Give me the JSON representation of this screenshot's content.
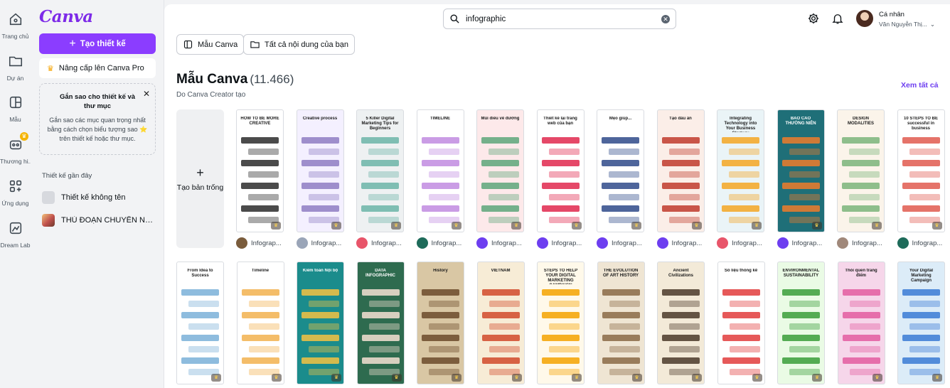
{
  "rail": [
    {
      "label": "Trang chủ",
      "icon": "home-icon"
    },
    {
      "label": "Dự án",
      "icon": "folder-icon"
    },
    {
      "label": "Mẫu",
      "icon": "template-icon"
    },
    {
      "label": "Thương hi...",
      "icon": "brand-icon",
      "badge": "♛"
    },
    {
      "label": "Ứng dụng",
      "icon": "apps-icon"
    },
    {
      "label": "Dream Lab",
      "icon": "dream-lab-icon"
    }
  ],
  "panel": {
    "logo": "Canva",
    "create_label": "Tạo thiết kế",
    "upgrade_label": "Nâng cấp lên Canva Pro",
    "tip_title": "Gắn sao cho thiết kế và thư mục",
    "tip_body": "Gắn sao các mục quan trọng nhất bằng cách chọn biểu tượng sao ⭐ trên thiết kế hoặc thư mục.",
    "close_glyph": "✕",
    "recent_title": "Thiết kế gần đây",
    "recent": [
      {
        "label": "Thiết kế không tên"
      },
      {
        "label": "THỦ ĐOẠN CHUYỂN NH..."
      }
    ]
  },
  "header": {
    "search_value": "infographic",
    "clear_glyph": "✕",
    "account_name": "Cá nhân",
    "account_user": "Văn Nguyễn Thị...",
    "account_caret": "⌄"
  },
  "filters": [
    {
      "label": "Mẫu Canva"
    },
    {
      "label": "Tất cả nội dung của bạn"
    }
  ],
  "section": {
    "title": "Mẫu Canva",
    "count": "(11.466)",
    "subtitle": "Do Canva Creator tạo",
    "see_all": "Xem tất cả",
    "blank_label": "Tạo bản trống",
    "blank_plus": "+"
  },
  "row1": [
    {
      "title": "HOW TO BE MORE CREATIVE",
      "bg": "#ffffff",
      "accent": "#2b2b2b",
      "avatar": "#7a5c3c",
      "author": "Infograp..."
    },
    {
      "title": "Creative process",
      "bg": "#f4f0ff",
      "accent": "#8e7cc3",
      "avatar": "#9aa5b8",
      "author": "Infograp..."
    },
    {
      "title": "5 Killer Digital Marketing Tips for Beginners",
      "bg": "#eef1f2",
      "accent": "#6bb5a8",
      "avatar": "#e8556a",
      "author": "Infograp..."
    },
    {
      "title": "TIMELINE",
      "bg": "#ffffff",
      "accent": "#c18be0",
      "avatar": "#1e6b5a",
      "author": "Infograp..."
    },
    {
      "title": "Mùi điều về đường",
      "bg": "#fde9ea",
      "accent": "#5da67a",
      "avatar": "#6d3ef0",
      "author": "Infograp..."
    },
    {
      "title": "Thiết kế lại trang web của bạn",
      "bg": "#ffffff",
      "accent": "#e0284e",
      "avatar": "#6d3ef0",
      "author": "Infograp..."
    },
    {
      "title": "Mẹo giúp...",
      "bg": "#ffffff",
      "accent": "#2f4a8a",
      "avatar": "#6d3ef0",
      "author": "Infograp..."
    },
    {
      "title": "Tạo dấu ấn",
      "bg": "#fbeee8",
      "accent": "#c0392b",
      "avatar": "#6d3ef0",
      "author": "Infograp..."
    },
    {
      "title": "Integrating Technology into Your Business Strategy",
      "bg": "#eaf4f7",
      "accent": "#f5a623",
      "avatar": "#e8556a",
      "author": "Infograp..."
    },
    {
      "title": "BÁO CÁO THƯỜNG NIÊN",
      "bg": "#1f6f78",
      "accent": "#ef7d2a",
      "avatar": "#6d3ef0",
      "author": "Infograp..."
    },
    {
      "title": "DESIGN MODALITIES",
      "bg": "#fbf4ea",
      "accent": "#7ab47a",
      "avatar": "#a0887a",
      "author": "Infograp..."
    },
    {
      "title": "10 STEPS TO BE successful in business",
      "bg": "#ffffff",
      "accent": "#e05a4f",
      "avatar": "#1e6b5a",
      "author": "Infograp..."
    }
  ],
  "row2": [
    {
      "title": "From Idea to Success",
      "bg": "#ffffff",
      "accent": "#7ab0d8",
      "author": ""
    },
    {
      "title": "Timeline",
      "bg": "#ffffff",
      "accent": "#f2b24f",
      "author": ""
    },
    {
      "title": "Kiểm toán Nội bộ",
      "bg": "#1b8c8c",
      "accent": "#f5c242",
      "author": ""
    },
    {
      "title": "DATA INFOGRAPHIC",
      "bg": "#2e6b4f",
      "accent": "#f4e1d2",
      "author": ""
    },
    {
      "title": "History",
      "bg": "#d9c7a4",
      "accent": "#6b4a2b",
      "author": ""
    },
    {
      "title": "VIETNAM",
      "bg": "#f7ecd6",
      "accent": "#d14a2a",
      "author": ""
    },
    {
      "title": "STEPS TO HELP YOUR DIGITAL MARKETING CAMPAIGN SUCCESS",
      "bg": "#fff9ea",
      "accent": "#f5a300",
      "author": ""
    },
    {
      "title": "THE EVOLUTION OF ART HISTORY",
      "bg": "#efe5d3",
      "accent": "#8a6a45",
      "author": ""
    },
    {
      "title": "Ancient Civilizations",
      "bg": "#f3ead8",
      "accent": "#4a3a2a",
      "author": ""
    },
    {
      "title": "Số liệu thống kê",
      "bg": "#ffffff",
      "accent": "#e23c3c",
      "author": ""
    },
    {
      "title": "ENVIRONMENTAL SUSTAINABILITY",
      "bg": "#eafbe5",
      "accent": "#3a9d3a",
      "author": ""
    },
    {
      "title": "Thói quen trang điểm",
      "bg": "#f6d6ea",
      "accent": "#e35ca0",
      "author": ""
    },
    {
      "title": "Your Digital Marketing Campaign",
      "bg": "#dcecf8",
      "accent": "#3a7bd5",
      "author": ""
    }
  ]
}
